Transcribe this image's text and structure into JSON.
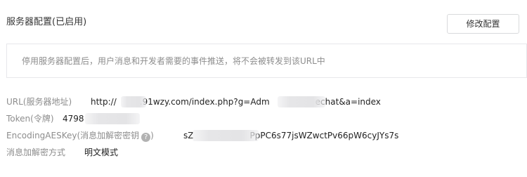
{
  "header": {
    "title": "服务器配置(已启用)",
    "modify_button": "修改配置"
  },
  "notice": {
    "text": "停用服务器配置后，用户消息和开发者需要的事件推送，将不会被转发到该URL中"
  },
  "config": {
    "url_label": "URL(服务器地址)",
    "url_value_prefix": "http://",
    "url_value_mid": ".91wzy.com/index.php?g=Adm",
    "url_value_suffix": "echat&a=index",
    "token_label": "Token(令牌)",
    "token_value": "4798",
    "aes_label": "EncodingAESKey(消息加解密密钥",
    "aes_help_icon": "?",
    "aes_label_close": ")",
    "aes_value_prefix": "sZ",
    "aes_value_suffix": "PpPC6s77jsWZwctPv66pW6cyJYs7s",
    "mode_label": "消息加解密方式",
    "mode_value": "明文模式"
  }
}
